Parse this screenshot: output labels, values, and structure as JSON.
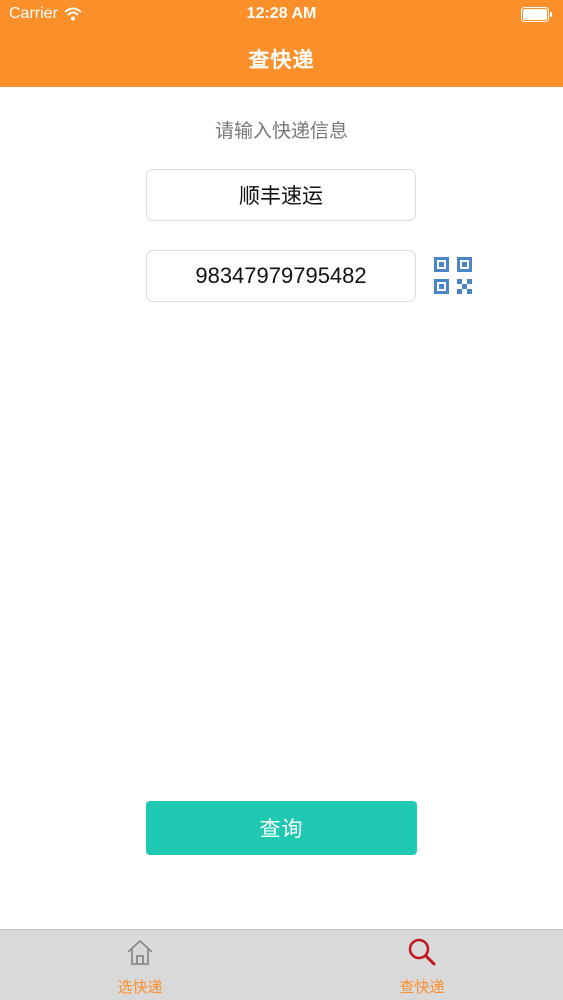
{
  "status_bar": {
    "carrier": "Carrier",
    "time": "12:28 AM"
  },
  "nav": {
    "title": "查快递"
  },
  "form": {
    "prompt": "请输入快递信息",
    "company": "顺丰速运",
    "tracking_number": "98347979795482",
    "query_label": "查询"
  },
  "tabs": [
    {
      "label": "选快递",
      "icon": "home-icon"
    },
    {
      "label": "查快递",
      "icon": "search-icon"
    }
  ],
  "colors": {
    "header": "#fb8f2a",
    "button": "#1fc8b1",
    "tab_label": "#fb8f2a",
    "active_tab_icon": "#c0161c",
    "qr_icon": "#4a86c5"
  }
}
